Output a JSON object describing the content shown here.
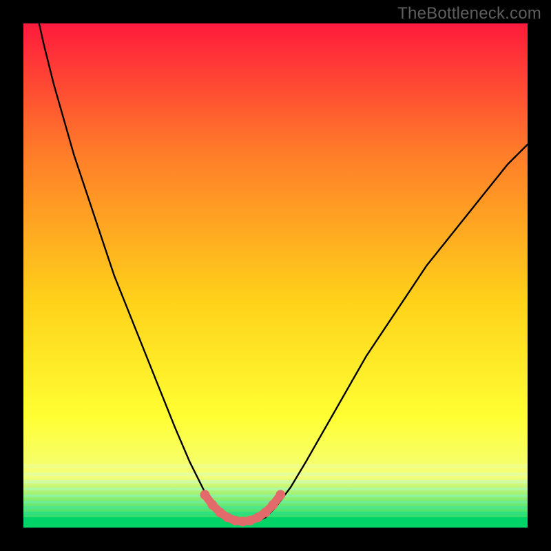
{
  "watermark": "TheBottleneck.com",
  "colors": {
    "page_bg": "#000000",
    "grad_top": "#ff1a3c",
    "grad_mid1": "#ff7a2a",
    "grad_mid2": "#ffd21a",
    "grad_low1": "#ffff33",
    "grad_low2": "#f4ff7a",
    "grad_bottom": "#00d468",
    "curve": "#000000",
    "bottom_marker": "#e26a6a"
  },
  "chart_data": {
    "type": "line",
    "title": "",
    "xlabel": "",
    "ylabel": "",
    "xlim": [
      0,
      100
    ],
    "ylim": [
      0,
      100
    ],
    "series": [
      {
        "name": "main-curve",
        "x": [
          0,
          2,
          4,
          6,
          8,
          10,
          12,
          14,
          16,
          18,
          20,
          22,
          24,
          26,
          28,
          30,
          33,
          36,
          38,
          40,
          42,
          44,
          46,
          48,
          50,
          53,
          56,
          60,
          64,
          68,
          72,
          76,
          80,
          84,
          88,
          92,
          96,
          100
        ],
        "y": [
          116,
          105,
          96,
          88,
          81,
          74,
          68,
          62,
          56,
          50,
          45,
          40,
          35,
          30,
          25,
          20,
          13,
          7,
          4,
          2,
          1.2,
          1,
          1.2,
          2,
          4,
          8,
          13,
          20,
          27,
          34,
          40,
          46,
          52,
          57,
          62,
          67,
          72,
          76
        ]
      },
      {
        "name": "bottom-dots",
        "x": [
          36,
          37.5,
          39,
          40.5,
          42,
          43.5,
          45,
          46.5,
          48,
          49.5,
          51
        ],
        "y": [
          6.5,
          4.5,
          3,
          2,
          1.4,
          1.2,
          1.4,
          2,
          3,
          4.5,
          6.5
        ]
      }
    ],
    "gradient_stops": [
      {
        "pos": 0.0,
        "color": "#ff1a3c"
      },
      {
        "pos": 0.25,
        "color": "#ff7a2a"
      },
      {
        "pos": 0.55,
        "color": "#ffd21a"
      },
      {
        "pos": 0.78,
        "color": "#ffff33"
      },
      {
        "pos": 0.9,
        "color": "#f4ff7a"
      },
      {
        "pos": 1.0,
        "color": "#00d468"
      }
    ]
  }
}
